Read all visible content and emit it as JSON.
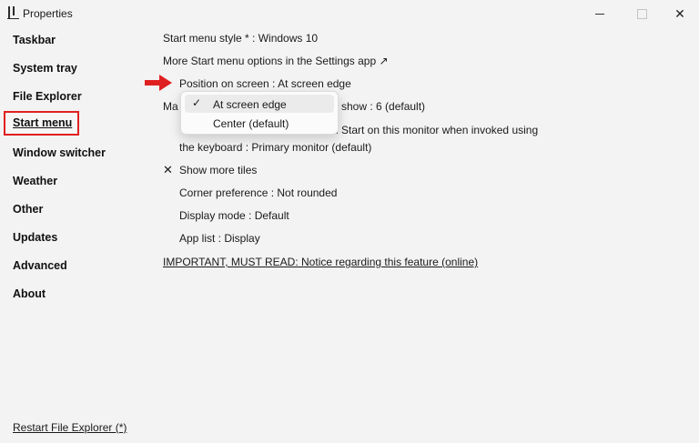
{
  "window": {
    "title": "Properties",
    "close_glyph": "✕"
  },
  "sidebar": {
    "items": [
      {
        "label": "Taskbar"
      },
      {
        "label": "System tray"
      },
      {
        "label": "File Explorer"
      },
      {
        "label": "Start menu",
        "active": true
      },
      {
        "label": "Window switcher"
      },
      {
        "label": "Weather"
      },
      {
        "label": "Other"
      },
      {
        "label": "Updates"
      },
      {
        "label": "Advanced"
      },
      {
        "label": "About"
      }
    ],
    "footer_link": "Restart File Explorer (*)"
  },
  "main": {
    "start_menu_style": "Start menu style * : Windows 10",
    "more_options_link": "More Start menu options in the Settings app ↗",
    "position_on_screen": "Position on screen : At screen edge",
    "max_frequent_prefix": "Ma",
    "max_frequent_suffix": "o show : 6 (default)",
    "monitor_line1_suffix": "n Start on this monitor when invoked using",
    "monitor_line2": "the keyboard : Primary monitor (default)",
    "show_more_tiles_mark": "✕",
    "show_more_tiles": "Show more tiles",
    "corner_preference": "Corner preference : Not rounded",
    "display_mode": "Display mode : Default",
    "app_list": "App list : Display",
    "important_link": "IMPORTANT, MUST READ: Notice regarding this feature (online)"
  },
  "dropdown": {
    "check_glyph": "✓",
    "options": [
      {
        "label": "At screen edge",
        "selected": true
      },
      {
        "label": "Center (default)",
        "selected": false
      }
    ]
  },
  "colors": {
    "annotation_red": "#e02020",
    "background": "#f3f3f3"
  }
}
